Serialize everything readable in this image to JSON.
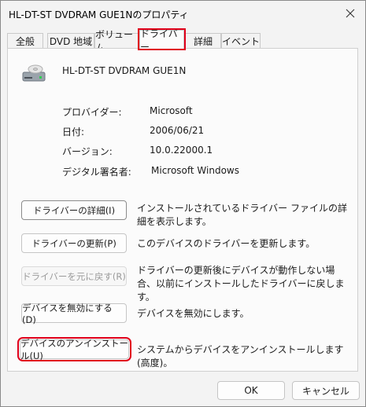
{
  "window": {
    "title": "HL-DT-ST DVDRAM GUE1Nのプロパティ"
  },
  "tabs": [
    {
      "label": "全般"
    },
    {
      "label": "DVD 地域"
    },
    {
      "label": "ボリューム"
    },
    {
      "label": "ドライバー"
    },
    {
      "label": "詳細"
    },
    {
      "label": "イベント"
    }
  ],
  "active_tab": "ドライバー",
  "device": {
    "name": "HL-DT-ST DVDRAM GUE1N"
  },
  "info": [
    {
      "label": "プロバイダー:",
      "value": "Microsoft"
    },
    {
      "label": "日付:",
      "value": "2006/06/21"
    },
    {
      "label": "バージョン:",
      "value": "10.0.22000.1"
    },
    {
      "label": "デジタル署名者:",
      "value": "Microsoft Windows"
    }
  ],
  "actions": [
    {
      "button": "ドライバーの詳細(I)",
      "description": "インストールされているドライバー ファイルの詳細を表示します。"
    },
    {
      "button": "ドライバーの更新(P)",
      "description": "このデバイスのドライバーを更新します。"
    },
    {
      "button": "ドライバーを元に戻す(R)",
      "description": "ドライバーの更新後にデバイスが動作しない場合、以前にインストールしたドライバーに戻します。"
    },
    {
      "button": "デバイスを無効にする(D)",
      "description": "デバイスを無効にします。"
    },
    {
      "button": "デバイスのアンインストール(U)",
      "description": "システムからデバイスをアンインストールします (高度)。"
    }
  ],
  "footer": {
    "ok": "OK",
    "cancel": "キャンセル"
  },
  "colors": {
    "highlight": "#e0001a",
    "window_bg": "#f3f3f3",
    "panel_bg": "#fbfbfb"
  }
}
